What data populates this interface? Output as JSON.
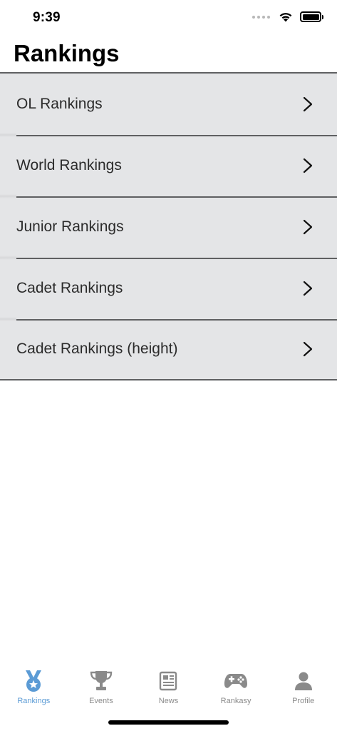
{
  "status_bar": {
    "time": "9:39",
    "icons": [
      "signal-dots-icon",
      "wifi-icon",
      "battery-icon"
    ]
  },
  "header": {
    "title": "Rankings"
  },
  "list": {
    "items": [
      {
        "label": "OL Rankings",
        "icon": "chevron-right-icon"
      },
      {
        "label": "World Rankings",
        "icon": "chevron-right-icon"
      },
      {
        "label": "Junior Rankings",
        "icon": "chevron-right-icon"
      },
      {
        "label": "Cadet Rankings",
        "icon": "chevron-right-icon"
      },
      {
        "label": "Cadet Rankings (height)",
        "icon": "chevron-right-icon"
      }
    ]
  },
  "tab_bar": {
    "active": "Rankings",
    "active_color": "#5b9bd5",
    "inactive_color": "#8a8a8a",
    "tabs": [
      {
        "label": "Rankings",
        "icon": "medal-icon"
      },
      {
        "label": "Events",
        "icon": "trophy-icon"
      },
      {
        "label": "News",
        "icon": "newspaper-icon"
      },
      {
        "label": "Rankasy",
        "icon": "gamepad-icon"
      },
      {
        "label": "Profile",
        "icon": "person-icon"
      }
    ]
  }
}
